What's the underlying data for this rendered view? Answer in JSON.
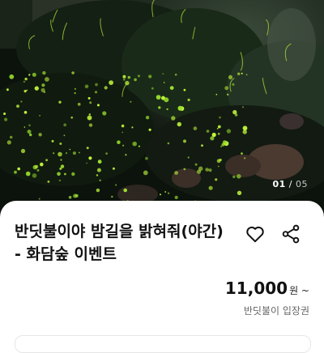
{
  "hero": {
    "image_counter_current": "01",
    "image_counter_separator": "/",
    "image_counter_total": "05"
  },
  "product": {
    "title": "반딧불이야 밤길을 밝혀줘(야간) - 화담숲 이벤트",
    "price": "11,000",
    "price_unit": "원 ~",
    "ticket_name": "반딧불이 입장권"
  },
  "icons": {
    "like": "heart-icon",
    "share": "share-icon"
  }
}
